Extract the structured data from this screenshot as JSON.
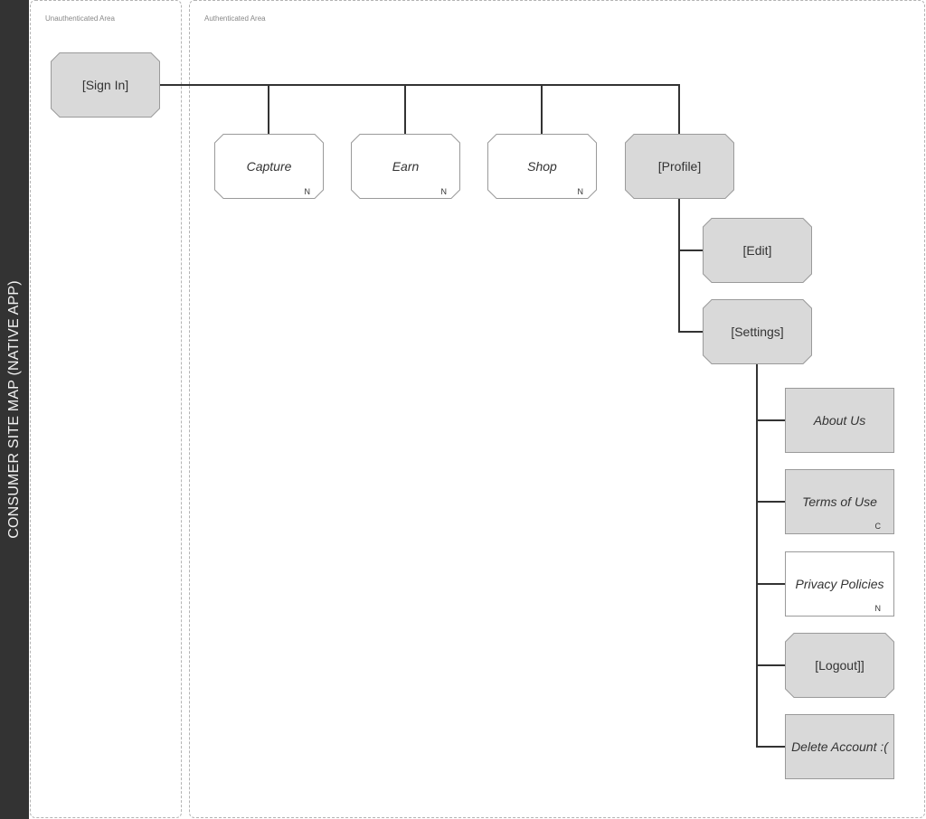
{
  "title": "CONSUMER SITE MAP (NATIVE APP)",
  "zones": {
    "unauthenticated": "Unauthenticated Area",
    "authenticated": "Authenticated Area"
  },
  "colors": {
    "sidebar": "#333333",
    "node_gray": "#d9d9d9",
    "node_white": "#ffffff",
    "connector": "#333333"
  },
  "nodes": {
    "signin": {
      "label": "[Sign In]",
      "badge": ""
    },
    "capture": {
      "label": "Capture",
      "badge": "N"
    },
    "earn": {
      "label": "Earn",
      "badge": "N"
    },
    "shop": {
      "label": "Shop",
      "badge": "N"
    },
    "profile": {
      "label": "[Profile]",
      "badge": ""
    },
    "edit": {
      "label": "[Edit]",
      "badge": ""
    },
    "settings": {
      "label": "[Settings]",
      "badge": ""
    },
    "about": {
      "label": "About Us",
      "badge": ""
    },
    "terms": {
      "label": "Terms of Use",
      "badge": "C"
    },
    "privacy": {
      "label": "Privacy Policies",
      "badge": "N"
    },
    "logout": {
      "label": "[Logout]]",
      "badge": ""
    },
    "delete": {
      "label": "Delete Account :(",
      "badge": ""
    }
  },
  "edges": [
    [
      "signin",
      "capture"
    ],
    [
      "signin",
      "earn"
    ],
    [
      "signin",
      "shop"
    ],
    [
      "signin",
      "profile"
    ],
    [
      "profile",
      "edit"
    ],
    [
      "profile",
      "settings"
    ],
    [
      "settings",
      "about"
    ],
    [
      "settings",
      "terms"
    ],
    [
      "settings",
      "privacy"
    ],
    [
      "settings",
      "logout"
    ],
    [
      "settings",
      "delete"
    ]
  ]
}
